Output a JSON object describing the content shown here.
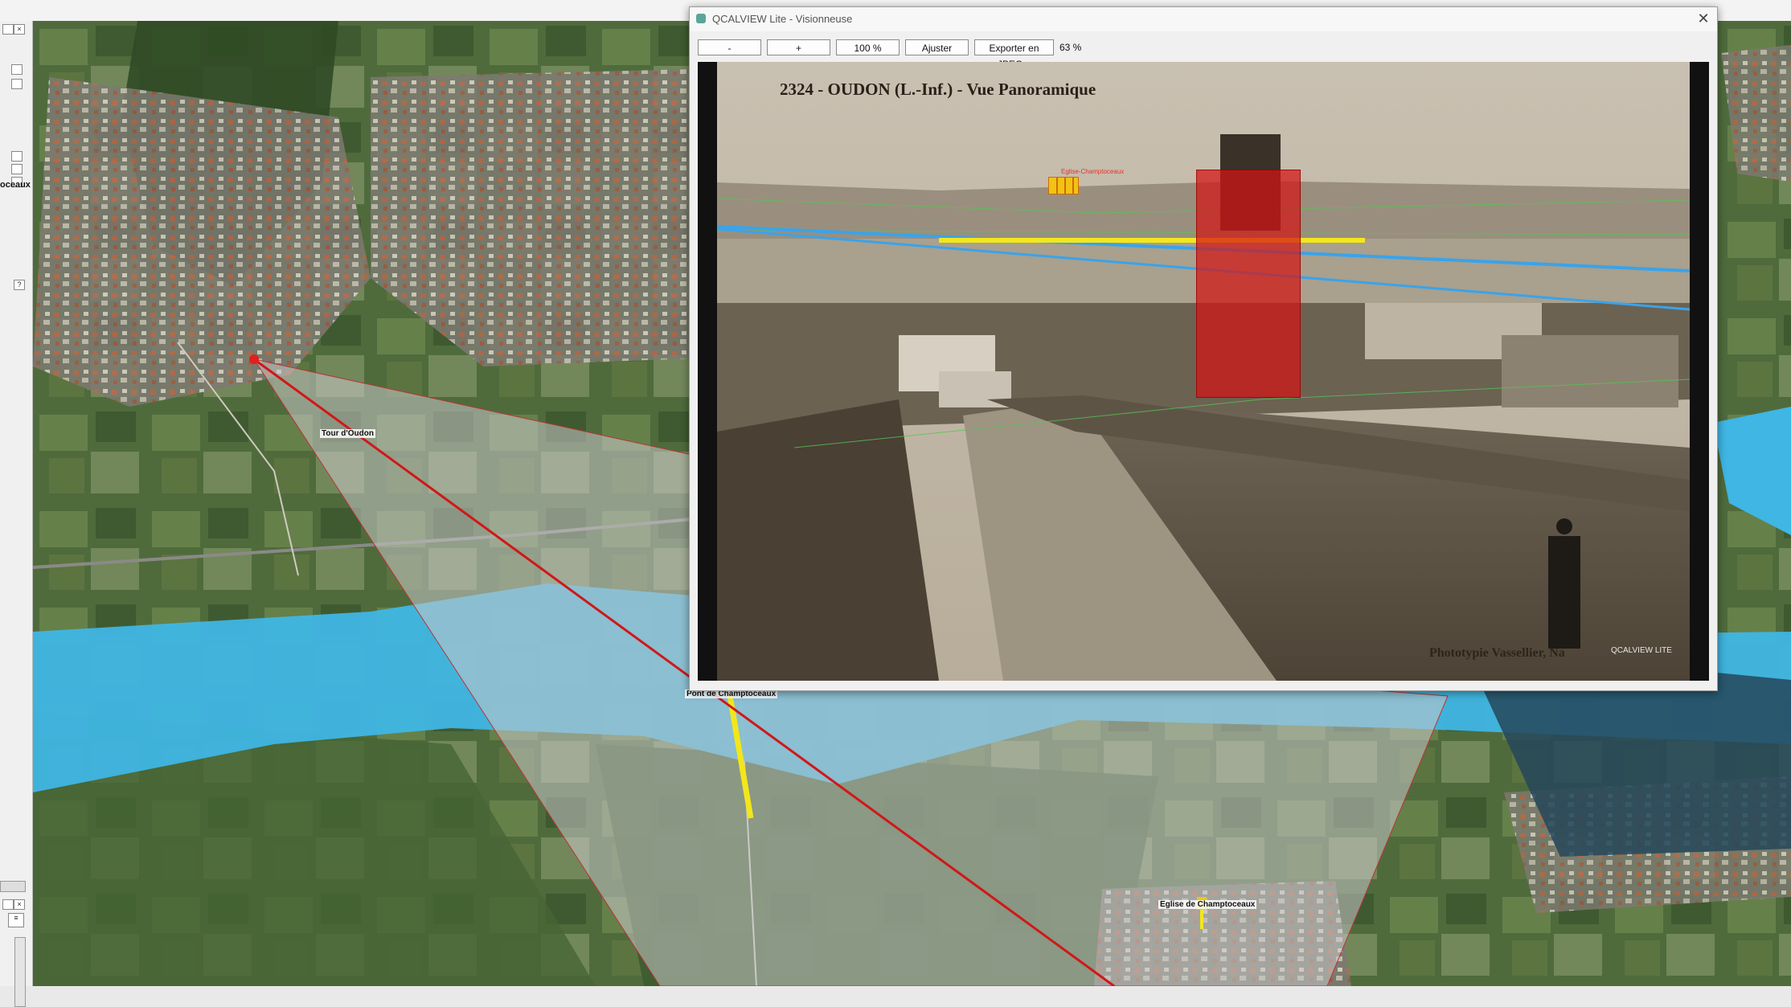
{
  "viewer": {
    "title": "QCALVIEW Lite - Visionneuse",
    "close_label": "✕",
    "toolbar": {
      "zoom_out_label": "-",
      "zoom_in_label": "+",
      "zoom_100_label": "100 %",
      "fit_label": "Ajuster",
      "export_label": "Exporter en JPEG...",
      "zoom_level": "63 %"
    },
    "photo": {
      "title": "2324 - OUDON (L.-Inf.) - Vue Panoramique",
      "credit": "Phototypie Vassellier, Na",
      "watermark": "QCALVIEW LITE",
      "church_label": "Eglise-Champtoceaux"
    }
  },
  "map": {
    "labels": {
      "tour": "Tour d'Oudon",
      "pont": "Pont de Champtoceaux",
      "eglise": "Eglise de Champtoceaux"
    },
    "colors": {
      "river": "#3fb6e4",
      "viewshed": "rgba(200,200,200,0.55)",
      "sightline": "#d01818",
      "bridge": "#f3e71a",
      "tower_overlay": "#d21414"
    }
  },
  "left_panel": {
    "label_text": "oceaux",
    "help_symbol": "?"
  }
}
